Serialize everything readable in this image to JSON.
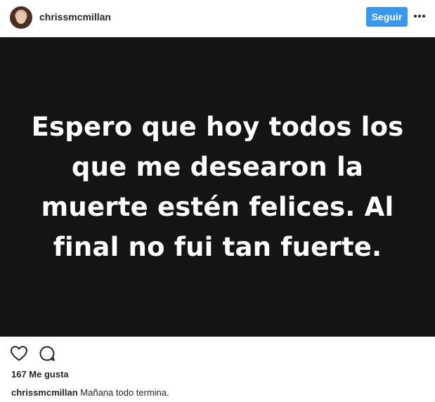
{
  "header": {
    "username": "chrissmcmillan",
    "follow_label": "Seguir"
  },
  "post": {
    "image_text": "Espero que hoy todos los que me desearon la muerte estén felices. Al final no fui tan fuerte.",
    "likes_text": "167 Me gusta"
  },
  "caption": {
    "username": "chrissmcmillan",
    "text": "Mañana todo termina."
  },
  "icons": {
    "like": "heart-icon",
    "comment": "comment-icon",
    "more": "more-icon"
  },
  "colors": {
    "follow_button": "#3897f0",
    "image_background": "#141414"
  }
}
